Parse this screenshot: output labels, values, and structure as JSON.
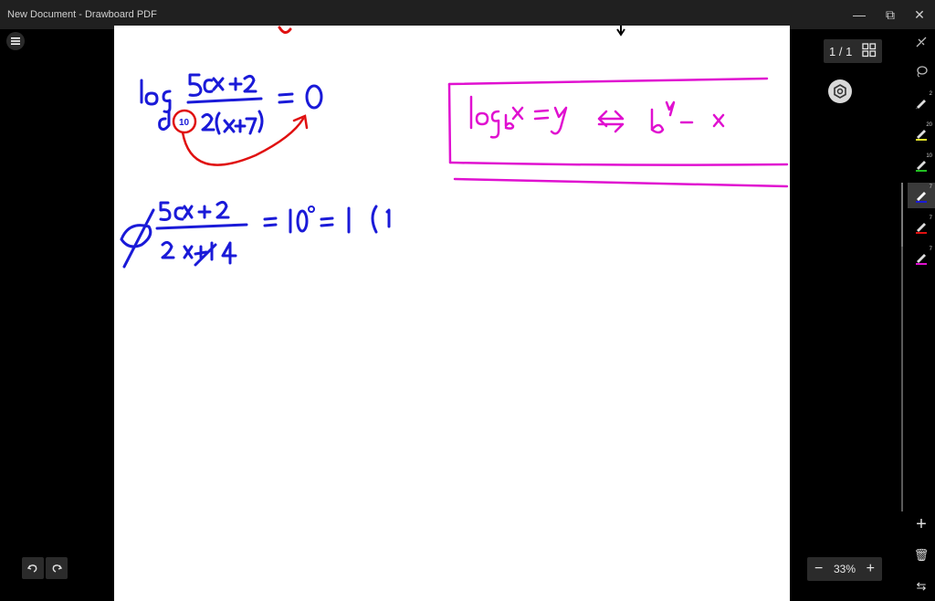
{
  "window": {
    "title": "New Document - Drawboard PDF",
    "minimize": "—",
    "restore": "⧉",
    "close": "✕"
  },
  "pager": {
    "label": "1 / 1"
  },
  "zoom": {
    "minus": "−",
    "value": "33%",
    "plus": "+"
  },
  "toolbar": {
    "tools": [
      {
        "name": "ruler-tool",
        "sub": ""
      },
      {
        "name": "lasso-tool",
        "sub": ""
      },
      {
        "name": "pen-tool-1",
        "sub": "2"
      },
      {
        "name": "highlighter-tool",
        "sub": "20"
      },
      {
        "name": "pen-tool-green",
        "sub": "10"
      },
      {
        "name": "pen-tool-blue",
        "sub": "7"
      },
      {
        "name": "pen-tool-red",
        "sub": "7"
      },
      {
        "name": "pen-tool-magenta",
        "sub": "7"
      }
    ],
    "add": "+",
    "delete": "🗑",
    "swap": "⇆"
  },
  "colors": {
    "ink_blue": "#1a1ad8",
    "ink_red": "#e01010",
    "ink_magenta": "#e010d0"
  }
}
